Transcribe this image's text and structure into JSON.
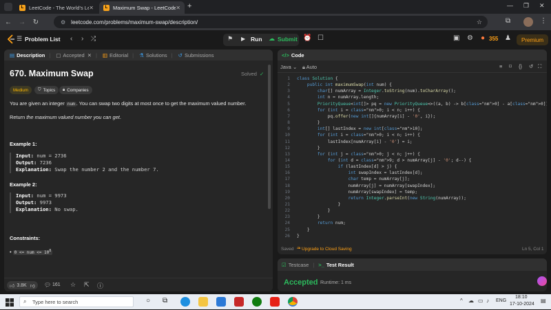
{
  "browser": {
    "tabs": [
      {
        "title": "LeetCode - The World's Leadi",
        "active": false
      },
      {
        "title": "Maximum Swap - LeetCode",
        "active": true
      }
    ],
    "new_tab": "+",
    "url": "leetcode.com/problems/maximum-swap/description/"
  },
  "lc_nav": {
    "problem_list": "Problem List",
    "run": "Run",
    "submit": "Submit",
    "streak": "355",
    "premium": "Premium"
  },
  "left_tabs": [
    "Description",
    "Accepted",
    "Editorial",
    "Solutions",
    "Submissions"
  ],
  "problem": {
    "title": "670. Maximum Swap",
    "status": "Solved",
    "difficulty": "Medium",
    "topics": "Topics",
    "companies": "Companies",
    "desc1_a": "You are given an integer",
    "desc1_code": "num",
    "desc1_b": ". You can swap two digits at most once to get the maximum valued number.",
    "desc2_a": "Return ",
    "desc2_em": "the maximum valued number you can get",
    "desc2_b": ".",
    "ex1_title": "Example 1:",
    "ex1": {
      "input_label": "Input:",
      "input": "num = 2736",
      "output_label": "Output:",
      "output": "7236",
      "expl_label": "Explanation:",
      "expl": "Swap the number 2 and the number 7."
    },
    "ex2_title": "Example 2:",
    "ex2": {
      "input_label": "Input:",
      "input": "num = 9973",
      "output_label": "Output:",
      "output": "9973",
      "expl_label": "Explanation:",
      "expl": "No swap."
    },
    "constraints_title": "Constraints:",
    "constraint": "0 <= num <= 10",
    "constraint_sup": "8"
  },
  "bottom": {
    "likes": "3.8K",
    "comments": "161"
  },
  "editor": {
    "tab": "Code",
    "language": "Java",
    "mode": "Auto",
    "saved": "Saved",
    "upgrade": "Upgrade to Cloud Saving",
    "cursor": "Ln 5, Col 1"
  },
  "code_lines": [
    "class Solution {",
    "    public int maximumSwap(int num) {",
    "        char[] numArray = Integer.toString(num).toCharArray();",
    "        int n = numArray.length;",
    "        PriorityQueue<int[]> pq = new PriorityQueue<>((a, b) -> b[0] - a[0]);",
    "        for (int i = 0; i < n; i++) {",
    "            pq.offer(new int[]{numArray[i] - '0', i});",
    "        }",
    "        int[] lastIndex = new int[10];",
    "        for (int i = 0; i < n; i++) {",
    "            lastIndex[numArray[i] - '0'] = i;",
    "        }",
    "        for (int j = 0; j < n; j++) {",
    "            for (int d = 9; d > numArray[j] - '0'; d--) {",
    "                if (lastIndex[d] > j) {",
    "                    int swapIndex = lastIndex[d];",
    "                    char temp = numArray[j];",
    "                    numArray[j] = numArray[swapIndex];",
    "                    numArray[swapIndex] = temp;",
    "                    return Integer.parseInt(new String(numArray));",
    "                }",
    "            }",
    "        }",
    "        return num;",
    "    }",
    "}"
  ],
  "result": {
    "testcase": "Testcase",
    "test_result": "Test Result",
    "status": "Accepted",
    "runtime": "Runtime: 1 ms"
  },
  "taskbar": {
    "search": "Type here to search",
    "lang": "ENG",
    "time": "18:10",
    "date": "17-10-2024"
  }
}
